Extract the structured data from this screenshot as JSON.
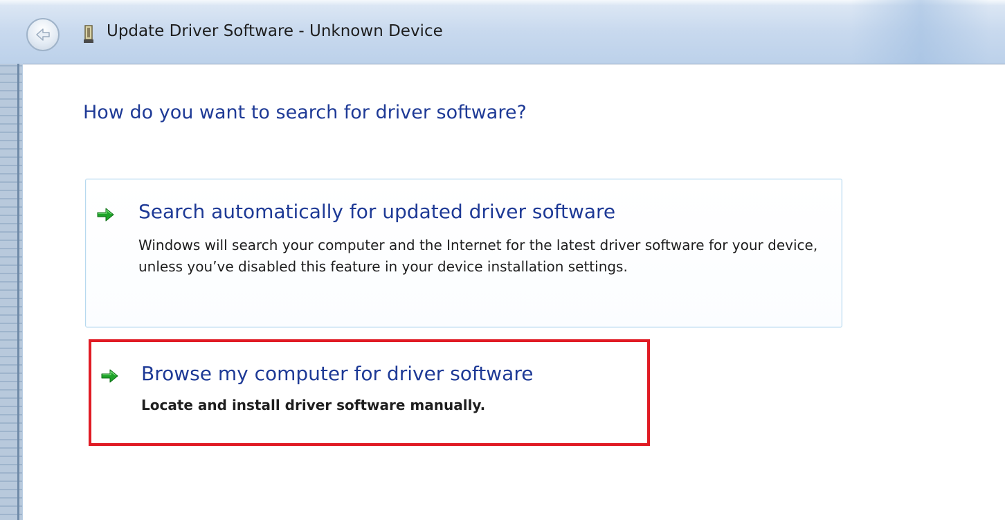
{
  "window": {
    "title": "Update Driver Software - Unknown Device"
  },
  "icons": {
    "back": "back-arrow-icon",
    "device": "device-icon",
    "option_arrow": "green-arrow-icon"
  },
  "colors": {
    "heading": "#1e3a96",
    "highlight": "#e01b24",
    "arrow": "#1fa32a"
  },
  "main": {
    "heading": "How do you want to search for driver software?",
    "options": [
      {
        "title": "Search automatically for updated driver software",
        "description": "Windows will search your computer and the Internet for the latest driver software for your device, unless you’ve disabled this feature in your device installation settings."
      },
      {
        "title": "Browse my computer for driver software",
        "description": "Locate and install driver software manually."
      }
    ]
  }
}
